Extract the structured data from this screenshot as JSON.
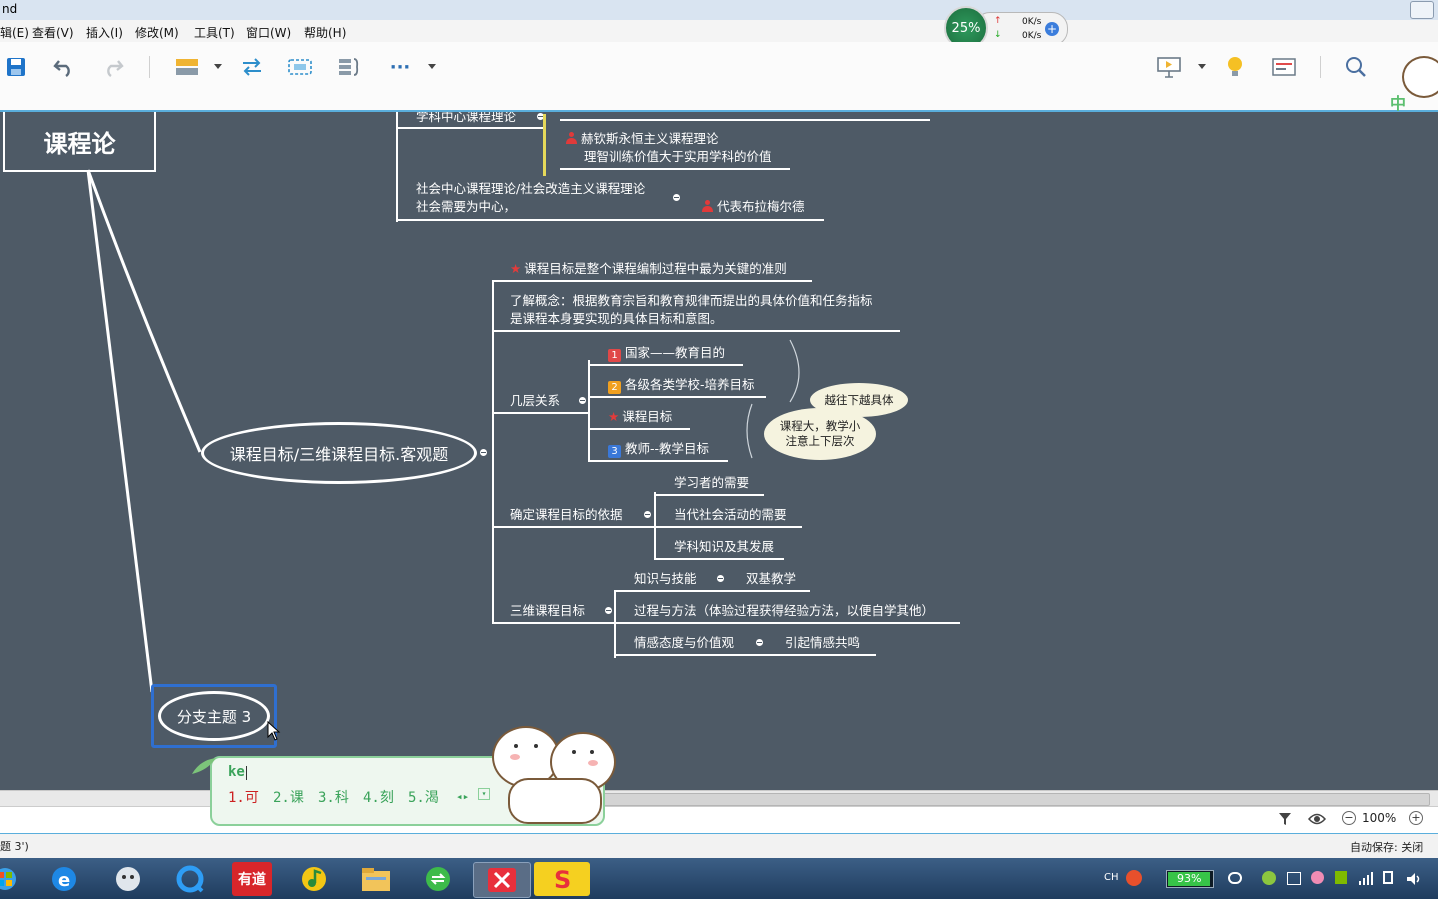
{
  "window": {
    "title": "nd"
  },
  "menu": [
    "辑(E)",
    "查看(V)",
    "插入(I)",
    "修改(M)",
    "工具(T)",
    "窗口(W)",
    "帮助(H)"
  ],
  "netmeter": {
    "percent": "25%",
    "up": "0K/s",
    "down": "0K/s"
  },
  "toolbar": {
    "more": "···"
  },
  "mindmap": {
    "root": "课程论",
    "top_branch": {
      "subject_theory": "学科中心课程理论",
      "hutchins": "赫钦斯永恒主义课程理论",
      "hutchins_note": "理智训练价值大于实用学科的价值",
      "social_theory_line1": "社会中心课程理论/社会改造主义课程理论",
      "social_theory_line2": "社会需要为中心，",
      "brameld": "代表布拉梅尔德"
    },
    "goal_branch": {
      "title": "课程目标/三维课程目标.客观题",
      "key_note": "课程目标是整个课程编制过程中最为关键的准则",
      "concept_line1": "了解概念：根据教育宗旨和教育规律而提出的具体价值和任务指标",
      "concept_line2": "是课程本身要实现的具体目标和意图。",
      "levels": {
        "label": "几层关系",
        "items": [
          {
            "badge": "1",
            "text": "国家——教育目的"
          },
          {
            "badge": "2",
            "text": "各级各类学校-培养目标"
          },
          {
            "badge": "★",
            "text": "课程目标"
          },
          {
            "badge": "3",
            "text": "教师--教学目标"
          }
        ],
        "bubble1": "越往下越具体",
        "bubble2_line1": "课程大，教学小",
        "bubble2_line2": "注意上下层次"
      },
      "basis": {
        "label": "确定课程目标的依据",
        "items": [
          "学习者的需要",
          "当代社会活动的需要",
          "学科知识及其发展"
        ]
      },
      "three_dim": {
        "label": "三维课程目标",
        "knowledge": "知识与技能",
        "knowledge_child": "双基教学",
        "process": "过程与方法（体验过程获得经验方法，以便自学其他）",
        "emotion": "情感态度与价值观",
        "emotion_child": "引起情感共鸣"
      }
    },
    "branch3": "分支主题 3"
  },
  "ime": {
    "input": "ke",
    "candidates": [
      "1.可",
      "2.课",
      "3.科",
      "4.刻",
      "5.渴"
    ]
  },
  "bottombar": {
    "zoom": "100%"
  },
  "status": {
    "left": "题 3')",
    "autosave": "自动保存: 关闭"
  },
  "taskbar": {
    "youdao": "有道",
    "lang": "CH",
    "battery": "93%"
  }
}
